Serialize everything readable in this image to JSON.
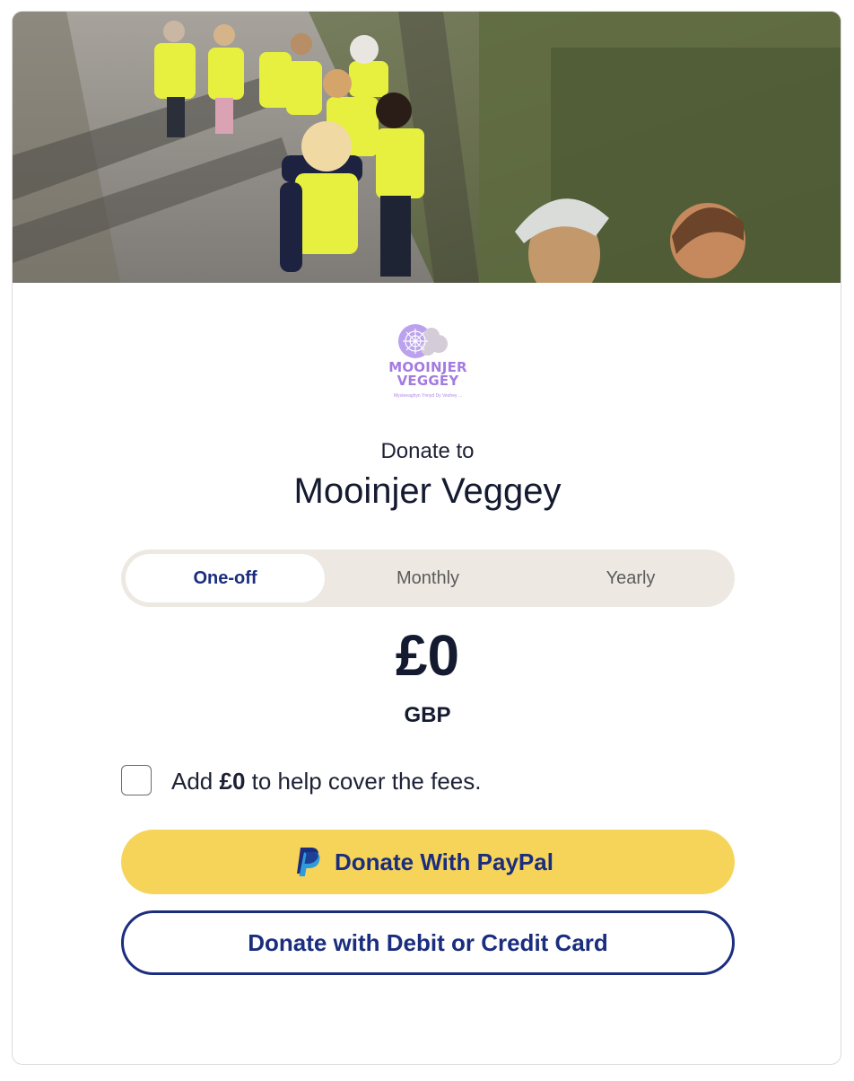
{
  "hero": {
    "image": "Group of young children in yellow hi-vis vests walking along a path"
  },
  "logo": {
    "icon": "flower-cloud-logo",
    "name": "MOOINJER\nVEGGEY",
    "tagline": "Mysteeaghyn Ynnyd Dy Veshey ..."
  },
  "header": {
    "donate_to": "Donate to",
    "org_name": "Mooinjer Veggey"
  },
  "frequency": {
    "tabs": [
      {
        "label": "One-off",
        "active": true
      },
      {
        "label": "Monthly",
        "active": false
      },
      {
        "label": "Yearly",
        "active": false
      }
    ]
  },
  "amount": {
    "value": "£0",
    "currency": "GBP"
  },
  "fees": {
    "prefix": "Add ",
    "amount": "£0",
    "suffix": " to help cover the fees.",
    "checked": false
  },
  "buttons": {
    "paypal_label": "Donate With PayPal",
    "paypal_icon": "paypal-icon",
    "card_label": "Donate with Debit or Credit Card"
  },
  "colors": {
    "brand_navy": "#1b2d7e",
    "paypal_yellow": "#f6d45a",
    "toggle_bg": "#ede9e2",
    "logo_purple": "#a47be0"
  }
}
